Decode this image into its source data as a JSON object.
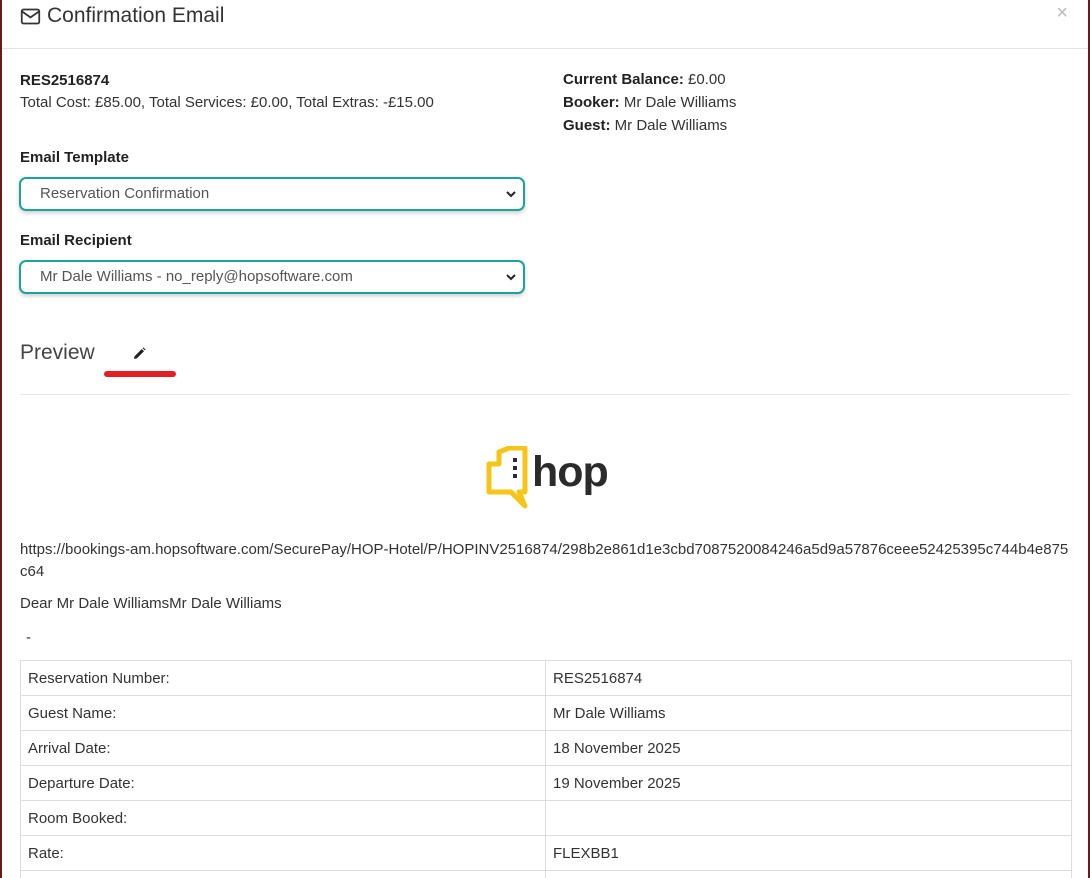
{
  "modal": {
    "title": "Confirmation Email",
    "close_label": "×"
  },
  "summary": {
    "reservation_id": "RES2516874",
    "totals": "Total Cost: £85.00, Total Services: £0.00, Total Extras: -£15.00",
    "balance_label": "Current Balance:",
    "balance_value": " £0.00",
    "booker_label": "Booker:",
    "booker_value": " Mr Dale Williams",
    "guest_label": "Guest:",
    "guest_value": " Mr Dale Williams"
  },
  "form": {
    "template_label": "Email Template",
    "template_value": "Reservation Confirmation",
    "recipient_label": "Email Recipient",
    "recipient_value": "Mr Dale Williams - no_reply@hopsoftware.com"
  },
  "preview": {
    "title": "Preview",
    "logo_text": "hop",
    "link": "https://bookings-am.hopsoftware.com/SecurePay/HOP-Hotel/P/HOPINV2516874/298b2e861d1e3cbd7087520084246a5d9a57876ceee52425395c744b4e875c64",
    "greeting": "Dear Mr Dale WilliamsMr Dale Williams",
    "dash": "-",
    "rows": [
      {
        "key": "Reservation Number:",
        "value": "RES2516874"
      },
      {
        "key": "Guest Name:",
        "value": "Mr Dale Williams"
      },
      {
        "key": "Arrival Date:",
        "value": "18 November 2025"
      },
      {
        "key": "Departure Date:",
        "value": "19 November 2025"
      },
      {
        "key": "Room Booked:",
        "value": ""
      },
      {
        "key": "Rate:",
        "value": "FLEXBB1"
      },
      {
        "key": "",
        "value": ""
      }
    ]
  },
  "colors": {
    "accent": "#1ba39c",
    "highlight": "#e31e24",
    "logo": "#f5c518"
  }
}
